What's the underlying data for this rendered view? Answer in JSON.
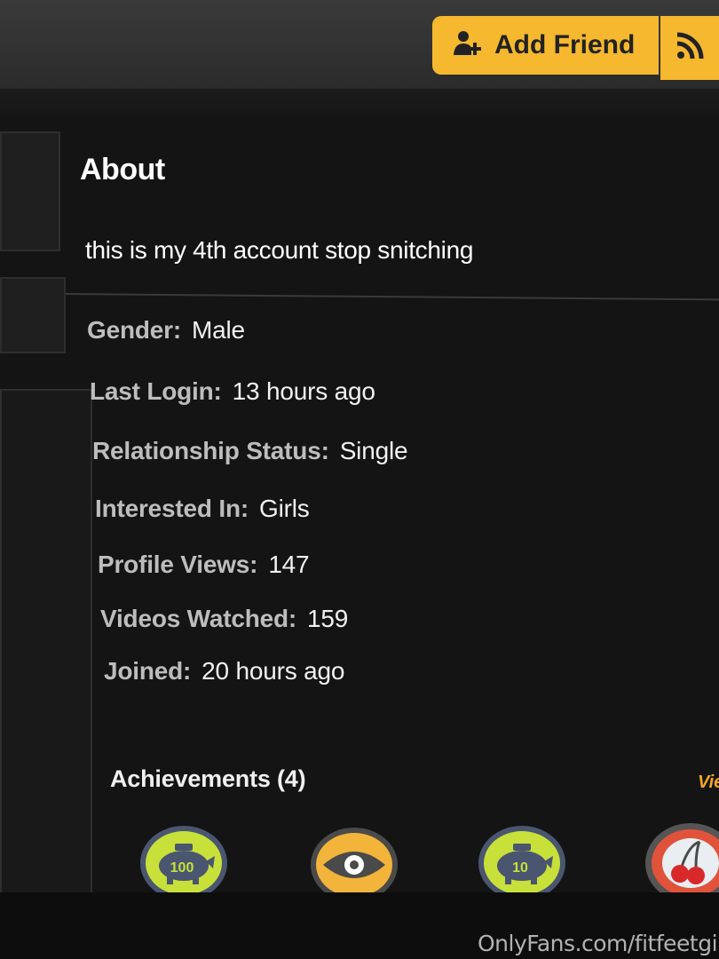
{
  "header": {
    "add_friend_label": "Add Friend",
    "accent_color": "#f5b82e"
  },
  "about": {
    "title": "About",
    "text": "this is my 4th account stop snitching"
  },
  "info": [
    {
      "key": "Gender:",
      "value": "Male"
    },
    {
      "key": "Last Login:",
      "value": "13 hours ago"
    },
    {
      "key": "Relationship Status:",
      "value": "Single"
    },
    {
      "key": "Interested In:",
      "value": "Girls"
    },
    {
      "key": "Profile Views:",
      "value": "147"
    },
    {
      "key": "Videos Watched:",
      "value": "159"
    },
    {
      "key": "Joined:",
      "value": "20 hours ago"
    }
  ],
  "achievements": {
    "title": "Achievements (4)",
    "view_link": "Vie",
    "badges": [
      {
        "icon": "piggy-bank-icon",
        "label": "100"
      },
      {
        "icon": "eye-icon",
        "label": ""
      },
      {
        "icon": "piggy-bank-icon",
        "label": "10"
      },
      {
        "icon": "cherries-icon",
        "label": ""
      }
    ]
  },
  "watermark": "OnlyFans.com/fitfeetgirl"
}
